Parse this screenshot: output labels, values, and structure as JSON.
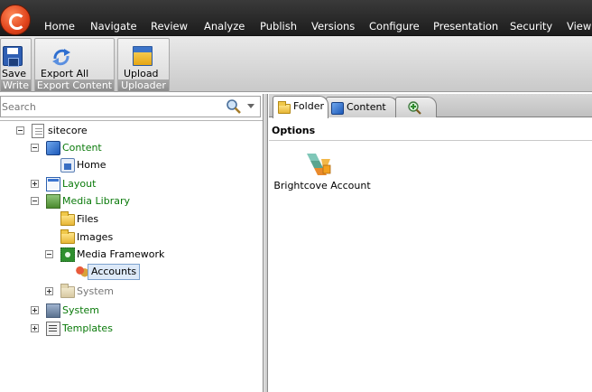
{
  "menu": {
    "items": [
      "Home",
      "Navigate",
      "Review",
      "Analyze",
      "Publish",
      "Versions",
      "Configure",
      "Presentation",
      "Security",
      "View"
    ]
  },
  "ribbon": {
    "write_group": {
      "save_label": "Save",
      "caption": "Write"
    },
    "export_group": {
      "export_all_label": "Export All",
      "caption": "Export Content"
    },
    "uploader_group": {
      "upload_label": "Upload",
      "caption": "Uploader"
    }
  },
  "search": {
    "placeholder": "Search"
  },
  "tree": {
    "sitecore": "sitecore",
    "content": "Content",
    "home": "Home",
    "layout": "Layout",
    "media_library": "Media Library",
    "files": "Files",
    "images": "Images",
    "media_framework": "Media Framework",
    "accounts": "Accounts",
    "system_sub": "System",
    "system": "System",
    "templates": "Templates"
  },
  "tabs": {
    "folder": "Folder",
    "content": "Content"
  },
  "options": {
    "title": "Options",
    "item_label": "Brightcove Account"
  },
  "colors": {
    "menubar": "#2a2a2a",
    "green_link": "#0a7a0a",
    "selection": "#dde9f8"
  }
}
